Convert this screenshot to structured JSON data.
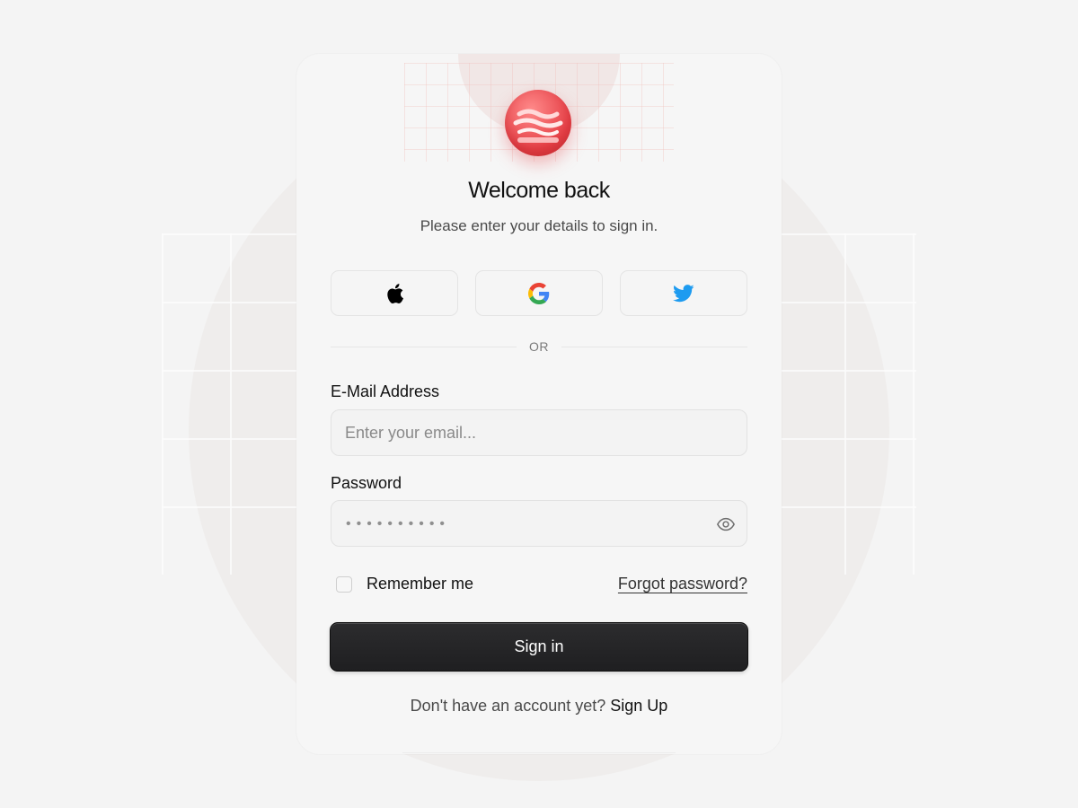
{
  "header": {
    "title": "Welcome back",
    "subtitle": "Please enter your details to sign in."
  },
  "social": [
    {
      "provider": "apple",
      "icon": "apple-icon"
    },
    {
      "provider": "google",
      "icon": "google-icon"
    },
    {
      "provider": "twitter",
      "icon": "twitter-icon"
    }
  ],
  "divider": {
    "label": "OR"
  },
  "form": {
    "email": {
      "label": "E-Mail Address",
      "placeholder": "Enter your email...",
      "value": ""
    },
    "password": {
      "label": "Password",
      "masked_value": "••••••••••",
      "toggle_icon": "eye-icon"
    },
    "remember": {
      "label": "Remember me",
      "checked": false
    },
    "forgot_label": "Forgot password?",
    "submit_label": "Sign in"
  },
  "footer": {
    "prompt": "Don't have an account yet?",
    "link_label": "Sign Up"
  },
  "colors": {
    "page_bg": "#f4f4f4",
    "card_bg": "#f6f6f6",
    "logo_red": "#e53f46",
    "primary_button": "#242426",
    "twitter_blue": "#1d9bf0"
  }
}
